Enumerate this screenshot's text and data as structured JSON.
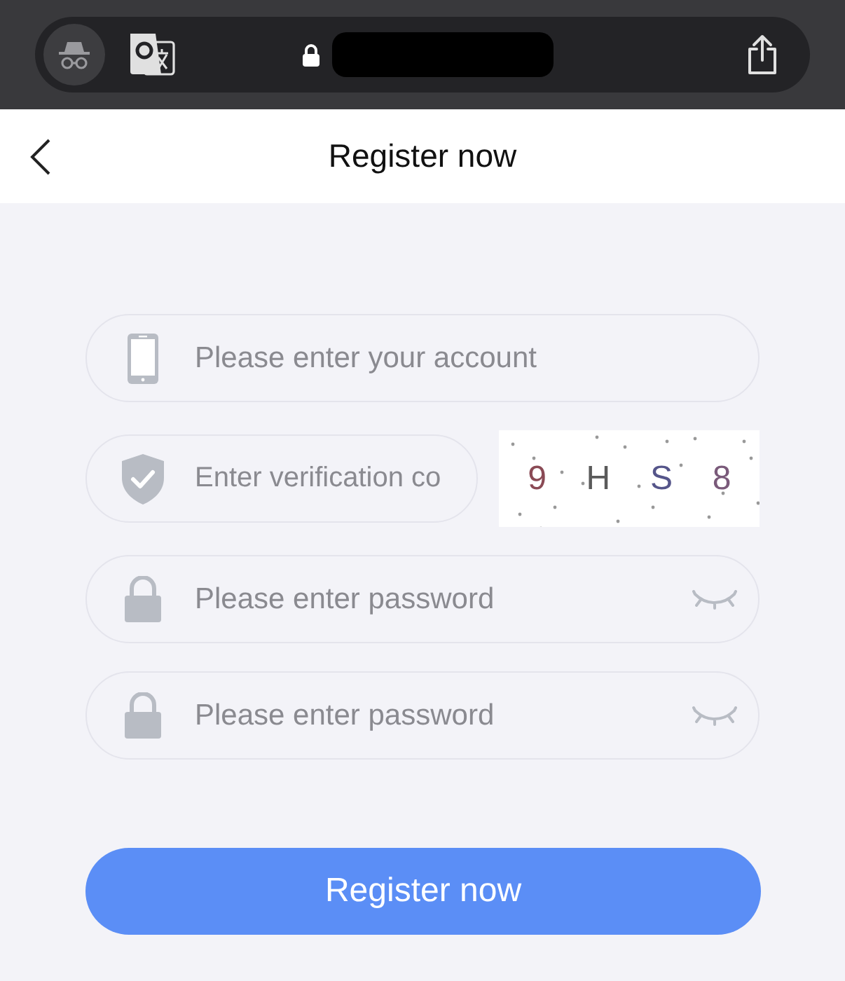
{
  "header": {
    "title": "Register now"
  },
  "fields": [
    {
      "kind": "account",
      "placeholder": "Please enter your account"
    },
    {
      "kind": "code",
      "placeholder": "Enter verification co"
    },
    {
      "kind": "password",
      "placeholder": "Please enter password"
    },
    {
      "kind": "password",
      "placeholder": "Please enter password"
    }
  ],
  "captcha": [
    {
      "char": "9",
      "color": "#8a4a55"
    },
    {
      "char": "H",
      "color": "#5a5a5a"
    },
    {
      "char": "S",
      "color": "#55558a"
    },
    {
      "char": "8",
      "color": "#7a5a7a"
    }
  ],
  "submit_button": "Register now"
}
